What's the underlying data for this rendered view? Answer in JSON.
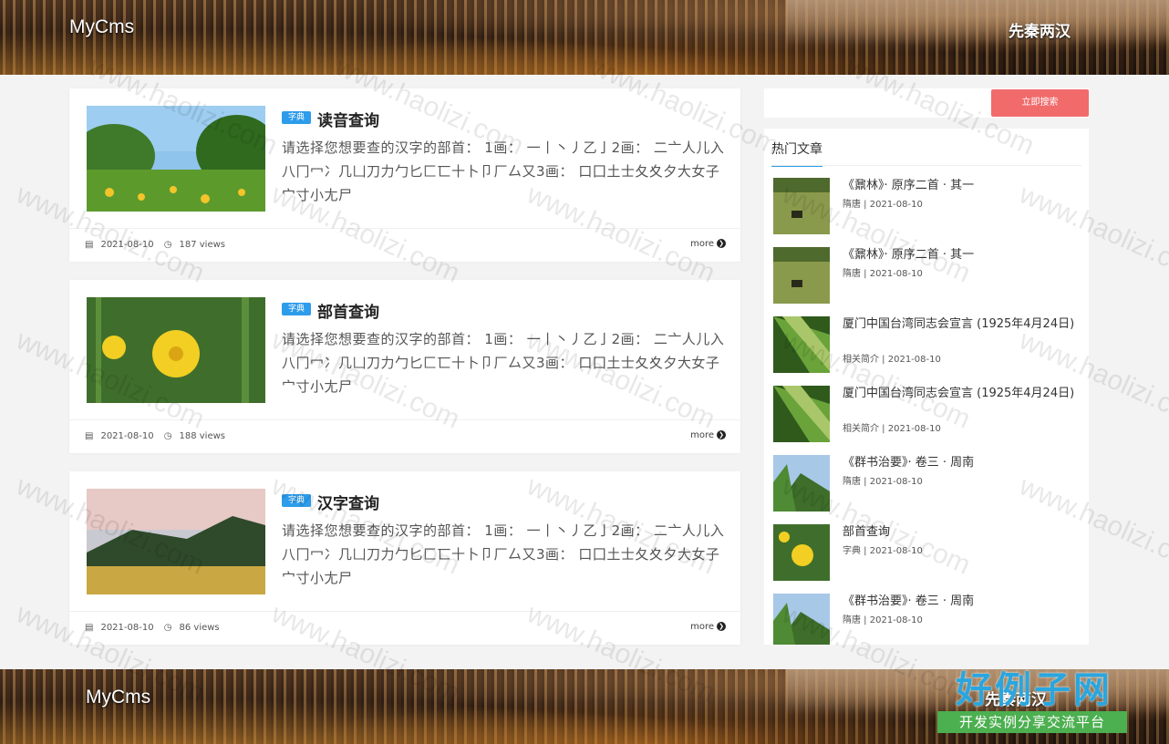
{
  "header": {
    "logo": "MyCms",
    "nav_item": "先秦两汉"
  },
  "footer_banner": {
    "logo": "MyCms",
    "nav_item": "先秦两汉"
  },
  "posts": [
    {
      "badge": "字典",
      "title": "读音查询",
      "summary": "请选择您想要查的汉字的部首： 1画： 一丨丶丿乙亅2画： 二亠人儿入八冂冖冫几凵刀力勹匕匚匸十卜卩厂厶又3画： 口囗土士夂夊夕大女子宀寸小尢尸",
      "date": "2021-08-10",
      "views": "187 views",
      "more": "more"
    },
    {
      "badge": "字典",
      "title": "部首查询",
      "summary": "请选择您想要查的汉字的部首： 1画： 一丨丶丿乙亅2画： 二亠人儿入八冂冖冫几凵刀力勹匕匚匸十卜卩厂厶又3画： 口囗土士夂夊夕大女子宀寸小尢尸",
      "date": "2021-08-10",
      "views": "188 views",
      "more": "more"
    },
    {
      "badge": "字典",
      "title": "汉字查询",
      "summary": "请选择您想要查的汉字的部首： 1画： 一丨丶丿乙亅2画： 二亠人儿入八冂冖冫几凵刀力勹匕匚匸十卜卩厂厶又3画： 口囗土士夂夊夕大女子宀寸小尢尸",
      "date": "2021-08-10",
      "views": "86 views",
      "more": "more"
    }
  ],
  "search": {
    "placeholder": "",
    "button": "立即搜索"
  },
  "hot": {
    "title": "热门文章",
    "items": [
      {
        "title": "《鼐林》· 原序二首 · 其一",
        "meta": "隋唐 | 2021-08-10"
      },
      {
        "title": "《鼐林》· 原序二首 · 其一",
        "meta": "隋唐 | 2021-08-10"
      },
      {
        "title": "厦门中国台湾同志会宣言 (1925年4月24日)",
        "meta": "相关简介 | 2021-08-10"
      },
      {
        "title": "厦门中国台湾同志会宣言 (1925年4月24日)",
        "meta": "相关简介 | 2021-08-10"
      },
      {
        "title": "《群书治要》· 卷三 · 周南",
        "meta": "隋唐 | 2021-08-10"
      },
      {
        "title": "部首查询",
        "meta": "字典 | 2021-08-10"
      },
      {
        "title": "《群书治要》· 卷三 · 周南",
        "meta": "隋唐 | 2021-08-10"
      }
    ]
  },
  "watermark": {
    "site": "www.haolizi.com",
    "logo_big": "好例子网",
    "logo_small": "开发实例分享交流平台"
  }
}
